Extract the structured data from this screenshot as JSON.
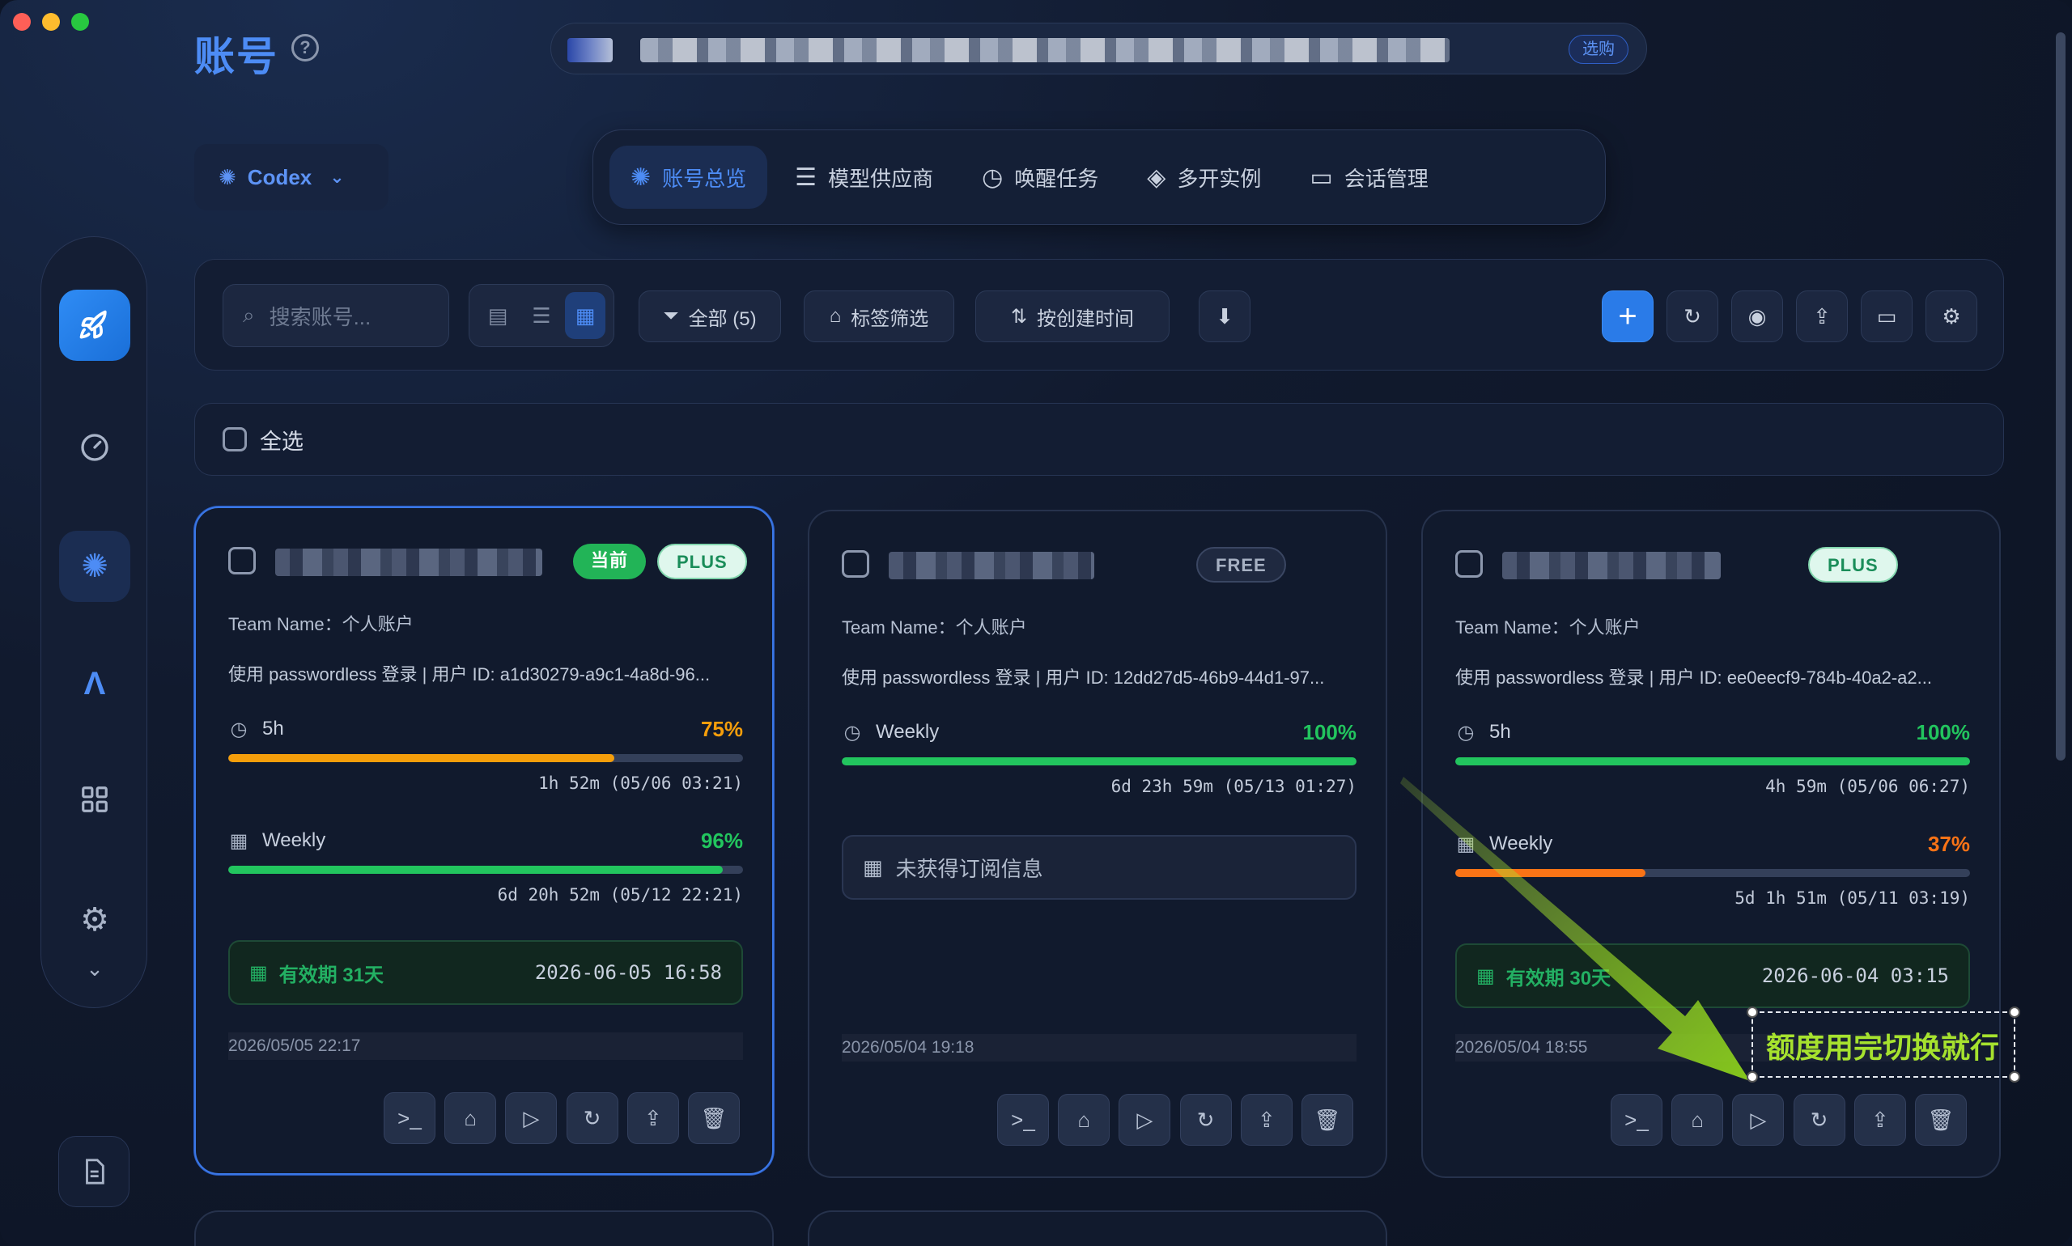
{
  "header": {
    "title": "账号",
    "help_icon": "question-circle-icon"
  },
  "promo": {
    "button": "选购"
  },
  "model_picker": {
    "label": "Codex",
    "icon": "openai-icon"
  },
  "top_tabs": [
    {
      "label": "账号总览",
      "icon": "openai-icon",
      "active": true
    },
    {
      "label": "模型供应商",
      "icon": "server-icon"
    },
    {
      "label": "唤醒任务",
      "icon": "clock-icon"
    },
    {
      "label": "多开实例",
      "icon": "layers-icon"
    },
    {
      "label": "会话管理",
      "icon": "folder-icon"
    }
  ],
  "sidebar": [
    {
      "name": "rocket-icon",
      "active": true
    },
    {
      "name": "gauge-icon"
    },
    {
      "name": "openai-icon"
    },
    {
      "name": "antigravity-icon"
    },
    {
      "name": "apps-grid-icon"
    },
    {
      "name": "settings-icon"
    },
    {
      "name": "chevron-down-icon"
    },
    {
      "name": "document-icon"
    }
  ],
  "toolbar": {
    "search_placeholder": "搜索账号...",
    "filter_all": "全部 (5)",
    "tag_filter": "标签筛选",
    "sort_label": "按创建时间"
  },
  "select_all": "全选",
  "cards": [
    {
      "current": true,
      "badges": [
        "当前",
        "PLUS"
      ],
      "team": "Team Name：个人账户",
      "login": "使用 passwordless 登录 | 用户 ID: a1d30279-a9c1-4a8d-96...",
      "quotas": [
        {
          "icon": "clock-icon",
          "label": "5h",
          "pct": "75%",
          "value": 0.75,
          "color": "#f59e0b",
          "reset": "1h 52m (05/06 03:21)"
        },
        {
          "icon": "calendar-icon",
          "label": "Weekly",
          "pct": "96%",
          "value": 0.96,
          "color": "#22c55e",
          "reset": "6d 20h 52m (05/12 22:21)"
        }
      ],
      "validity": {
        "label": "有效期 31天",
        "date": "2026-06-05 16:58"
      },
      "created": "2026/05/05 22:17"
    },
    {
      "current": false,
      "badges": [
        "FREE"
      ],
      "team": "Team Name：个人账户",
      "login": "使用 passwordless 登录 | 用户 ID: 12dd27d5-46b9-44d1-97...",
      "quotas": [
        {
          "icon": "clock-icon",
          "label": "Weekly",
          "pct": "100%",
          "value": 1.0,
          "color": "#22c55e",
          "reset": "6d 23h 59m (05/13 01:27)"
        }
      ],
      "no_subscription": "未获得订阅信息",
      "created": "2026/05/04 19:18"
    },
    {
      "current": false,
      "badges": [
        "PLUS"
      ],
      "team": "Team Name：个人账户",
      "login": "使用 passwordless 登录 | 用户 ID: ee0eecf9-784b-40a2-a2...",
      "quotas": [
        {
          "icon": "clock-icon",
          "label": "5h",
          "pct": "100%",
          "value": 1.0,
          "color": "#22c55e",
          "reset": "4h 59m (05/06 06:27)"
        },
        {
          "icon": "calendar-icon",
          "label": "Weekly",
          "pct": "37%",
          "value": 0.37,
          "color": "#f97316",
          "reset": "5d 1h 51m (05/11 03:19)"
        }
      ],
      "validity": {
        "label": "有效期 30天",
        "date": "2026-06-04 03:15"
      },
      "created": "2026/05/04 18:55"
    }
  ],
  "annotation": {
    "text": "额度用完切换就行"
  },
  "colors": {
    "accent": "#4d8cf5",
    "green": "#22c55e",
    "orange": "#f59e0b",
    "annotation": "#a6e22e"
  }
}
